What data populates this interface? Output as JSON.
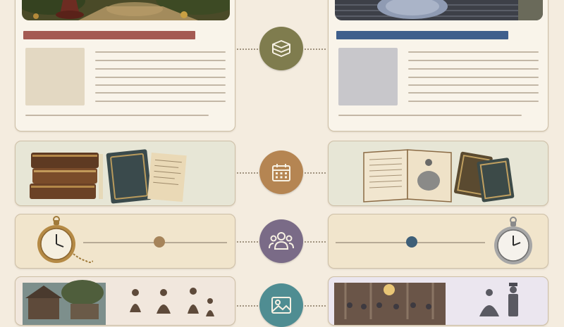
{
  "colors": {
    "background": "#f4ecdf",
    "left_title_bar": "#a45a52",
    "right_title_bar": "#3f5f8c",
    "icon_olive": "#7f7c4e",
    "icon_bronze": "#b58552",
    "icon_purple": "#7a6b87",
    "icon_teal": "#4f8d92",
    "slider_left": "#a6845a",
    "slider_right": "#3e5f78"
  },
  "timeline": {
    "rows": [
      {
        "icon": "books-stack-icon"
      },
      {
        "icon": "calendar-icon"
      },
      {
        "icon": "people-group-icon"
      },
      {
        "icon": "image-gallery-icon"
      }
    ]
  },
  "sliders": {
    "left": {
      "value": 0.53
    },
    "right": {
      "value": 0.51
    }
  }
}
